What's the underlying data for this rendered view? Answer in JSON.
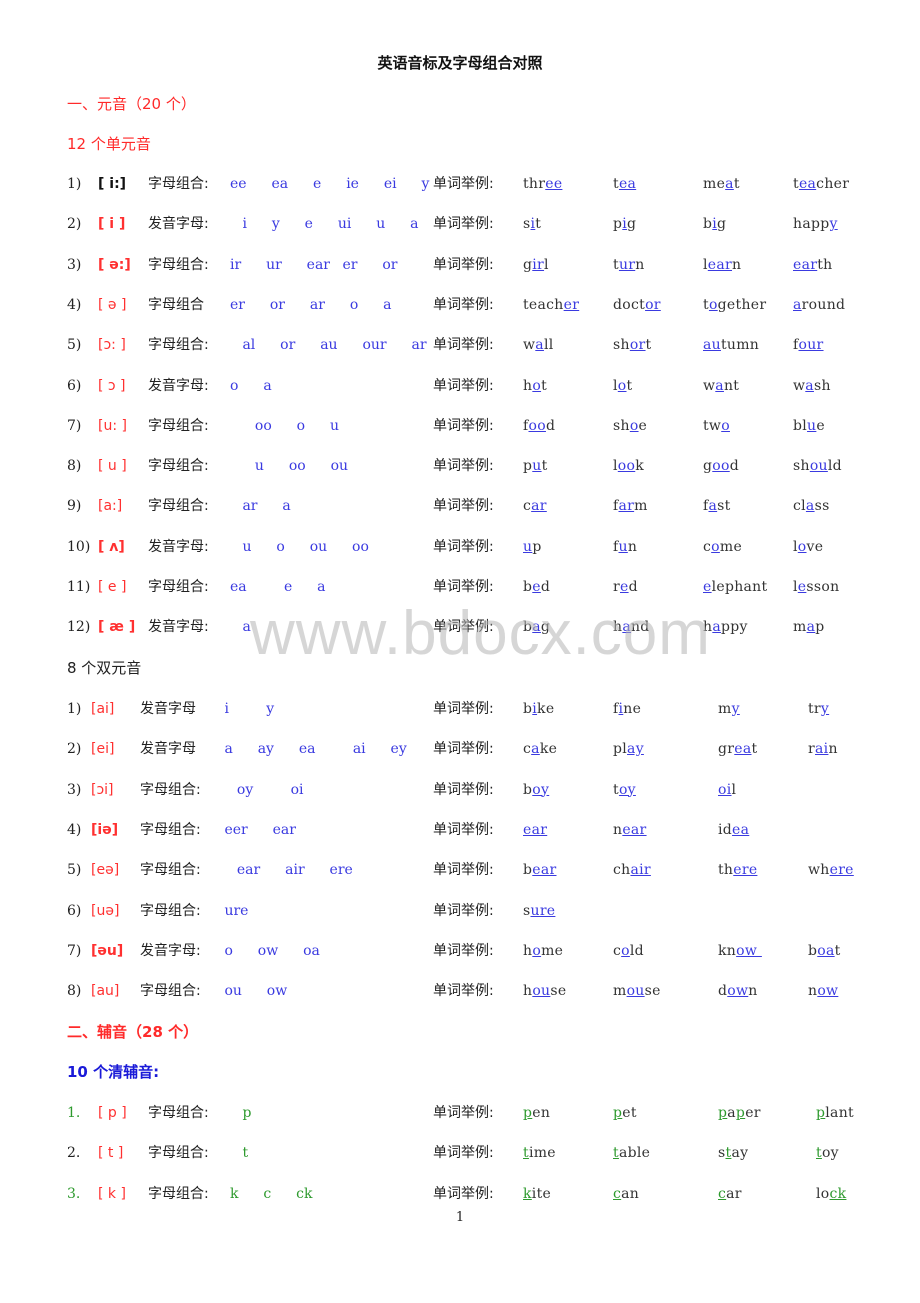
{
  "title": "英语音标及字母组合对照",
  "section1": {
    "label": "一、元音（20 个）"
  },
  "monophthongs_heading": "12 个单元音",
  "monophthongs": [
    {
      "num": "1)",
      "ipa": "[ i:]",
      "label": "字母组合:",
      "combos": "ee  ea  e  ie  ei  y",
      "example_label": "单词举例:",
      "words": [
        [
          "thr",
          "ee",
          ""
        ],
        [
          "t",
          "ea",
          ""
        ],
        [
          "me",
          "a",
          "t"
        ],
        [
          "t",
          "ea",
          "cher"
        ]
      ]
    },
    {
      "num": "2)",
      "ipa": "[ i ]",
      "label": "发音字母:",
      "combos": " i  y  e  ui  u  a",
      "example_label": "单词举例:",
      "words": [
        [
          "s",
          "i",
          "t"
        ],
        [
          "p",
          "i",
          "g"
        ],
        [
          "b",
          "i",
          "g"
        ],
        [
          "happ",
          "y",
          ""
        ]
      ]
    },
    {
      "num": "3)",
      "ipa": "[ ə:]",
      "label": "字母组合:",
      "combos": "ir  ur  ear er  or",
      "example_label": "单词举例:",
      "words": [
        [
          "g",
          "ir",
          "l"
        ],
        [
          "t",
          "ur",
          "n"
        ],
        [
          "l",
          "ear",
          "n"
        ],
        [
          "",
          "ear",
          "th"
        ]
      ]
    },
    {
      "num": "4)",
      "ipa": "[ ə ]",
      "label": "字母组合",
      "combos": "er  or  ar  o  a",
      "example_label": "单词举例:",
      "words": [
        [
          "teach",
          "er",
          ""
        ],
        [
          "doct",
          "or",
          ""
        ],
        [
          "t",
          "o",
          "gether"
        ],
        [
          "",
          "a",
          "round"
        ]
      ]
    },
    {
      "num": "5)",
      "ipa": "[ɔ: ]",
      "label": "字母组合:",
      "combos": " al  or  au  our  ar",
      "example_label": "单词举例:",
      "words": [
        [
          "w",
          "a",
          "ll"
        ],
        [
          "sh",
          "or",
          "t"
        ],
        [
          "",
          "au",
          "tumn"
        ],
        [
          "f",
          "our",
          ""
        ]
      ]
    },
    {
      "num": "6)",
      "ipa": "[ ɔ ]",
      "label": "发音字母:",
      "combos": "o  a",
      "example_label": "单词举例:",
      "words": [
        [
          "h",
          "o",
          "t"
        ],
        [
          "l",
          "o",
          "t"
        ],
        [
          "w",
          "a",
          "nt"
        ],
        [
          "w",
          "a",
          "sh"
        ]
      ]
    },
    {
      "num": "7)",
      "ipa": "[u: ]",
      "label": "字母组合:",
      "combos": "  oo  o  u",
      "example_label": "单词举例:",
      "words": [
        [
          "f",
          "oo",
          "d"
        ],
        [
          "sh",
          "o",
          "e"
        ],
        [
          "tw",
          "o",
          ""
        ],
        [
          "bl",
          "u",
          "e"
        ]
      ]
    },
    {
      "num": "8)",
      "ipa": "[ u ]",
      "label": "字母组合:",
      "combos": "  u  oo  ou",
      "example_label": "单词举例:",
      "words": [
        [
          "p",
          "u",
          "t"
        ],
        [
          "l",
          "oo",
          "k"
        ],
        [
          "g",
          "oo",
          "d"
        ],
        [
          "sh",
          "ou",
          "ld"
        ]
      ]
    },
    {
      "num": "9)",
      "ipa": "[a:]",
      "label": "字母组合:",
      "combos": " ar  a",
      "example_label": "单词举例:",
      "words": [
        [
          "c",
          "ar",
          ""
        ],
        [
          "f",
          "ar",
          "m"
        ],
        [
          "f",
          "a",
          "st"
        ],
        [
          "cl",
          "a",
          "ss"
        ]
      ]
    },
    {
      "num": "10)",
      "ipa": "[ ʌ]",
      "label": "发音字母:",
      "combos": " u  o  ou  oo",
      "example_label": "单词举例:",
      "words": [
        [
          "",
          "u",
          "p"
        ],
        [
          "f",
          "u",
          "n"
        ],
        [
          "c",
          "o",
          "me"
        ],
        [
          "l",
          "o",
          "ve"
        ]
      ]
    },
    {
      "num": "11)",
      "ipa": "[ e ]",
      "label": "字母组合:",
      "combos": "ea   e  a",
      "example_label": "单词举例:",
      "words": [
        [
          "b",
          "e",
          "d"
        ],
        [
          "r",
          "e",
          "d"
        ],
        [
          "",
          "e",
          "lephant"
        ],
        [
          "l",
          "e",
          "sson"
        ]
      ]
    },
    {
      "num": "12)",
      "ipa": "[ æ ]",
      "label": "发音字母:",
      "combos": " a",
      "example_label": "单词举例:",
      "words": [
        [
          "b",
          "a",
          "g"
        ],
        [
          "h",
          "a",
          "nd"
        ],
        [
          "h",
          "a",
          "ppy"
        ],
        [
          "m",
          "a",
          "p"
        ]
      ]
    }
  ],
  "diphthongs_heading": "8 个双元音",
  "diphthongs": [
    {
      "num": "1)",
      "ipa": "[ai]",
      "label": "发音字母",
      "combos": " i   y",
      "example_label": "单词举例:",
      "words": [
        [
          "b",
          "i",
          "ke"
        ],
        [
          "f",
          "i",
          "ne"
        ],
        [
          "m",
          "y",
          ""
        ],
        [
          "tr",
          "y",
          ""
        ]
      ]
    },
    {
      "num": "2)",
      "ipa": "[ei]",
      "label": "发音字母",
      "combos": " a  ay  ea   ai  ey",
      "example_label": "单词举例:",
      "words": [
        [
          "c",
          "a",
          "ke"
        ],
        [
          "pl",
          "ay",
          ""
        ],
        [
          "gr",
          "ea",
          "t"
        ],
        [
          "r",
          "ai",
          "n"
        ]
      ]
    },
    {
      "num": "3)",
      "ipa": "[ɔi]",
      "label": "字母组合:",
      "combos": "  oy   oi",
      "example_label": "单词举例:",
      "words": [
        [
          "b",
          "oy",
          ""
        ],
        [
          "t",
          "oy",
          ""
        ],
        [
          "",
          "oi",
          "l"
        ]
      ]
    },
    {
      "num": "4)",
      "ipa": "[iə]",
      "label": "字母组合:",
      "combos": " eer  ear",
      "example_label": "单词举例:",
      "words": [
        [
          "",
          "ear",
          ""
        ],
        [
          "n",
          "ear",
          ""
        ],
        [
          "id",
          "ea",
          ""
        ]
      ]
    },
    {
      "num": "5)",
      "ipa": "[eə]",
      "label": "字母组合:",
      "combos": "  ear  air  ere",
      "example_label": "单词举例:",
      "words": [
        [
          "b",
          "ear",
          ""
        ],
        [
          "ch",
          "air",
          ""
        ],
        [
          "th",
          "ere",
          ""
        ],
        [
          "wh",
          "ere",
          ""
        ]
      ]
    },
    {
      "num": "6)",
      "ipa": "[uə]",
      "label": "字母组合:",
      "combos": " ure",
      "example_label": "单词举例:",
      "words": [
        [
          "s",
          "ure",
          ""
        ]
      ]
    },
    {
      "num": "7)",
      "ipa": "[əu]",
      "label": "发音字母:",
      "combos": " o  ow  oa",
      "example_label": "单词举例:",
      "words": [
        [
          "h",
          "o",
          "me"
        ],
        [
          "c",
          "o",
          "ld"
        ],
        [
          "kn",
          "ow ",
          ""
        ],
        [
          "b",
          "oa",
          "t"
        ]
      ]
    },
    {
      "num": "8)",
      "ipa": "[au]",
      "label": "字母组合:",
      "combos": " ou  ow",
      "example_label": "单词举例:",
      "words": [
        [
          "h",
          "ou",
          "se"
        ],
        [
          "m",
          "ou",
          "se"
        ],
        [
          "d",
          "ow",
          "n"
        ],
        [
          "n",
          "ow",
          ""
        ]
      ]
    }
  ],
  "section2": {
    "label": "二、辅音（28 个）"
  },
  "voiceless_heading": "10 个清辅音:",
  "consonants": [
    {
      "num": "1.",
      "ipa": "[ p ]",
      "label": "字母组合:",
      "combos": " p",
      "example_label": "单词举例:",
      "words": [
        [
          "",
          "p",
          "en"
        ],
        [
          "",
          "p",
          "et"
        ],
        [
          "",
          "p",
          "a|p|er"
        ],
        [
          "",
          "p",
          "lant"
        ]
      ]
    },
    {
      "num": "2.",
      "ipa": "[ t ]",
      "label": "字母组合:",
      "combos": " t",
      "example_label": "单词举例:",
      "words": [
        [
          "",
          "t",
          "ime"
        ],
        [
          "",
          "t",
          "able"
        ],
        [
          "s",
          "t",
          "ay"
        ],
        [
          "",
          "t",
          "oy"
        ]
      ]
    },
    {
      "num": "3.",
      "ipa": "[ k ]",
      "label": "字母组合:",
      "combos": "k  c  ck",
      "example_label": "单词举例:",
      "words": [
        [
          "",
          "k",
          "ite"
        ],
        [
          "",
          "c",
          "an"
        ],
        [
          "",
          "c",
          "ar"
        ],
        [
          "lo",
          "ck",
          ""
        ]
      ]
    }
  ],
  "watermark": "www.bdocx.com",
  "page_number": "1",
  "colors": {
    "heading_red": "#ff2a2a",
    "combo_blue": "#2b2bd8",
    "consonant_green": "#2e9a2e",
    "voiceless_heading_blue": "#1a1ad8"
  }
}
